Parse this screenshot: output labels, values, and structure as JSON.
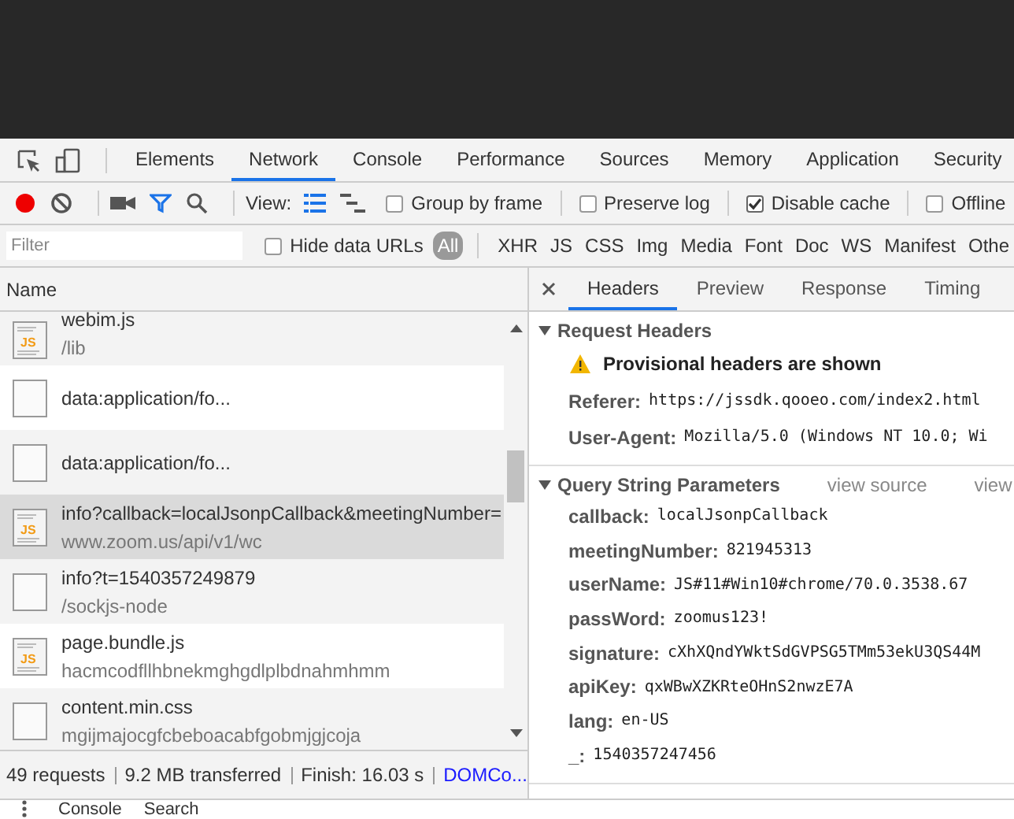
{
  "main_tabs": [
    {
      "label": "Elements",
      "selected": false
    },
    {
      "label": "Network",
      "selected": true
    },
    {
      "label": "Console",
      "selected": false
    },
    {
      "label": "Performance",
      "selected": false
    },
    {
      "label": "Sources",
      "selected": false
    },
    {
      "label": "Memory",
      "selected": false
    },
    {
      "label": "Application",
      "selected": false
    },
    {
      "label": "Security",
      "selected": false
    }
  ],
  "toolbar": {
    "recording": true,
    "filter_active": true,
    "view_label": "View:",
    "view_modes": [
      {
        "selected": true
      },
      {
        "selected": false
      }
    ],
    "options": [
      {
        "label": "Group by frame",
        "checked": false
      },
      {
        "label": "Preserve log",
        "checked": false
      },
      {
        "label": "Disable cache",
        "checked": true
      },
      {
        "label": "Offline",
        "checked": false
      }
    ]
  },
  "filter_bar": {
    "placeholder": "Filter",
    "hide_data_urls": {
      "label": "Hide data URLs",
      "checked": false
    },
    "types": [
      {
        "label": "All",
        "selected": true
      },
      {
        "label": "XHR",
        "selected": false
      },
      {
        "label": "JS",
        "selected": false
      },
      {
        "label": "CSS",
        "selected": false
      },
      {
        "label": "Img",
        "selected": false
      },
      {
        "label": "Media",
        "selected": false
      },
      {
        "label": "Font",
        "selected": false
      },
      {
        "label": "Doc",
        "selected": false
      },
      {
        "label": "WS",
        "selected": false
      },
      {
        "label": "Manifest",
        "selected": false
      },
      {
        "label": "Othe",
        "selected": false
      }
    ]
  },
  "requests": {
    "column": "Name",
    "rows": [
      {
        "name": "webim.js",
        "path": "/lib",
        "kind": "js",
        "icon_label": "JS",
        "selected": false
      },
      {
        "name": "data:application/fo...",
        "kind": "file",
        "selected": false
      },
      {
        "name": "data:application/fo...",
        "kind": "file",
        "selected": false
      },
      {
        "name": "info?callback=localJsonpCallback&meetingNumber=",
        "path": "www.zoom.us/api/v1/wc",
        "kind": "js",
        "icon_label": "JS",
        "selected": true
      },
      {
        "name": "info?t=1540357249879",
        "path": "/sockjs-node",
        "kind": "file",
        "selected": false
      },
      {
        "name": "page.bundle.js",
        "path": "hacmcodfllhbnekmghgdlplbdnahmhmm",
        "kind": "js",
        "icon_label": "JS",
        "selected": false
      },
      {
        "name": "content.min.css",
        "path": "mgijmajocgfcbeboacabfgobmjgjcoja",
        "kind": "file",
        "selected": false
      }
    ]
  },
  "status_bar": [
    {
      "text": "49 requests",
      "kind": "text"
    },
    {
      "text": "9.2 MB transferred",
      "kind": "text"
    },
    {
      "text": "Finish: 16.03 s",
      "kind": "text"
    },
    {
      "text": "DOMCo...",
      "kind": "link"
    }
  ],
  "detail_tabs": [
    {
      "label": "Headers",
      "selected": true
    },
    {
      "label": "Preview",
      "selected": false
    },
    {
      "label": "Response",
      "selected": false
    },
    {
      "label": "Timing",
      "selected": false
    }
  ],
  "request_headers": {
    "title": "Request Headers",
    "expanded": true,
    "warning": "Provisional headers are shown",
    "headers": [
      {
        "name": "Referer:",
        "value": "https://jssdk.qooeo.com/index2.html"
      },
      {
        "name": "User-Agent:",
        "value": "Mozilla/5.0 (Windows NT 10.0; Wi"
      }
    ]
  },
  "query_params": {
    "title": "Query String Parameters",
    "expanded": true,
    "actions": [
      "view source",
      "view"
    ],
    "params": [
      {
        "name": "callback:",
        "value": "localJsonpCallback"
      },
      {
        "name": "meetingNumber:",
        "value": "821945313"
      },
      {
        "name": "userName:",
        "value": "JS#11#Win10#chrome/70.0.3538.67"
      },
      {
        "name": "passWord:",
        "value": "zoomus123!"
      },
      {
        "name": "signature:",
        "value": "cXhXQndYWktSdGVPSG5TMm53ekU3QS44M"
      },
      {
        "name": "apiKey:",
        "value": "qxWBwXZKRteOHnS2nwzE7A"
      },
      {
        "name": "lang:",
        "value": "en-US"
      },
      {
        "name": "_:",
        "value": "1540357247456"
      }
    ]
  },
  "drawer_tabs": [
    "Console",
    "Search"
  ]
}
